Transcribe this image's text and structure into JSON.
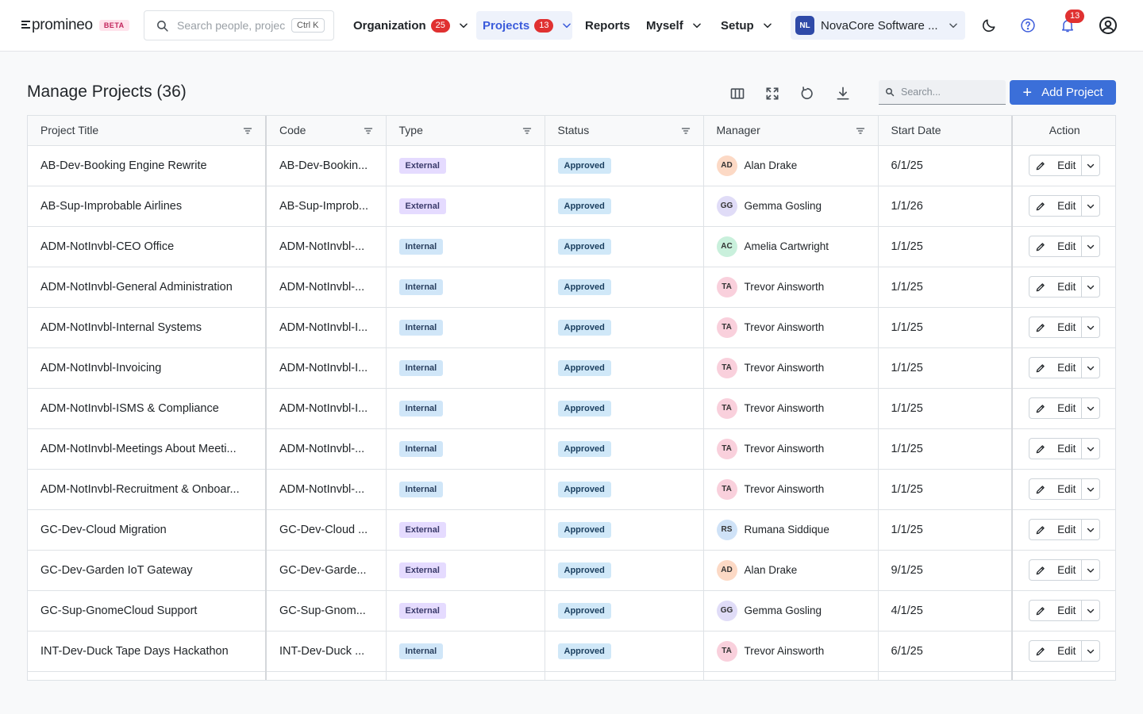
{
  "app": {
    "logo_text": "promineo",
    "beta_label": "BETA",
    "search_placeholder": "Search people, projects",
    "search_shortcut": "Ctrl K"
  },
  "nav": {
    "organization": {
      "label": "Organization",
      "badge": "25"
    },
    "projects": {
      "label": "Projects",
      "badge": "13"
    },
    "reports": {
      "label": "Reports"
    },
    "myself": {
      "label": "Myself"
    },
    "setup": {
      "label": "Setup"
    }
  },
  "org_switcher": {
    "initials": "NL",
    "name": "NovaCore Software ..."
  },
  "notifications": {
    "count": "13"
  },
  "page": {
    "title": "Manage Projects (36)",
    "search_placeholder": "Search...",
    "add_label": "Add Project"
  },
  "table": {
    "columns": [
      "Project Title",
      "Code",
      "Type",
      "Status",
      "Manager",
      "Start Date",
      "Action"
    ],
    "edit_label": "Edit",
    "rows": [
      {
        "title": "AB-Dev-Booking Engine Rewrite",
        "code": "AB-Dev-Bookin...",
        "type": "External",
        "status": "Approved",
        "initials": "AD",
        "manager": "Alan Drake",
        "start": "6/1/25"
      },
      {
        "title": "AB-Sup-Improbable Airlines",
        "code": "AB-Sup-Improb...",
        "type": "External",
        "status": "Approved",
        "initials": "GG",
        "manager": "Gemma Gosling",
        "start": "1/1/26"
      },
      {
        "title": "ADM-NotInvbl-CEO Office",
        "code": "ADM-NotInvbl-...",
        "type": "Internal",
        "status": "Approved",
        "initials": "AC",
        "manager": "Amelia Cartwright",
        "start": "1/1/25"
      },
      {
        "title": "ADM-NotInvbl-General Administration",
        "code": "ADM-NotInvbl-...",
        "type": "Internal",
        "status": "Approved",
        "initials": "TA",
        "manager": "Trevor Ainsworth",
        "start": "1/1/25"
      },
      {
        "title": "ADM-NotInvbl-Internal Systems",
        "code": "ADM-NotInvbl-I...",
        "type": "Internal",
        "status": "Approved",
        "initials": "TA",
        "manager": "Trevor Ainsworth",
        "start": "1/1/25"
      },
      {
        "title": "ADM-NotInvbl-Invoicing",
        "code": "ADM-NotInvbl-I...",
        "type": "Internal",
        "status": "Approved",
        "initials": "TA",
        "manager": "Trevor Ainsworth",
        "start": "1/1/25"
      },
      {
        "title": "ADM-NotInvbl-ISMS & Compliance",
        "code": "ADM-NotInvbl-I...",
        "type": "Internal",
        "status": "Approved",
        "initials": "TA",
        "manager": "Trevor Ainsworth",
        "start": "1/1/25"
      },
      {
        "title": "ADM-NotInvbl-Meetings About Meeti...",
        "code": "ADM-NotInvbl-...",
        "type": "Internal",
        "status": "Approved",
        "initials": "TA",
        "manager": "Trevor Ainsworth",
        "start": "1/1/25"
      },
      {
        "title": "ADM-NotInvbl-Recruitment & Onboar...",
        "code": "ADM-NotInvbl-...",
        "type": "Internal",
        "status": "Approved",
        "initials": "TA",
        "manager": "Trevor Ainsworth",
        "start": "1/1/25"
      },
      {
        "title": "GC-Dev-Cloud Migration",
        "code": "GC-Dev-Cloud ...",
        "type": "External",
        "status": "Approved",
        "initials": "RS",
        "manager": "Rumana Siddique",
        "start": "1/1/25"
      },
      {
        "title": "GC-Dev-Garden IoT Gateway",
        "code": "GC-Dev-Garde...",
        "type": "External",
        "status": "Approved",
        "initials": "AD",
        "manager": "Alan Drake",
        "start": "9/1/25"
      },
      {
        "title": "GC-Sup-GnomeCloud Support",
        "code": "GC-Sup-Gnom...",
        "type": "External",
        "status": "Approved",
        "initials": "GG",
        "manager": "Gemma Gosling",
        "start": "4/1/25"
      },
      {
        "title": "INT-Dev-Duck Tape Days Hackathon",
        "code": "INT-Dev-Duck ...",
        "type": "Internal",
        "status": "Approved",
        "initials": "TA",
        "manager": "Trevor Ainsworth",
        "start": "6/1/25"
      }
    ]
  },
  "colors": {
    "accent": "#3b6fd9",
    "nav_active": "#3b5bdb",
    "badge": "#e03131",
    "avatar_AD": "#fcd9c5",
    "avatar_GG": "#e0dcf7",
    "avatar_AC": "#c9f0dc",
    "avatar_TA": "#f9d0dc",
    "avatar_RS": "#cfe2f7"
  },
  "icons": [
    "search-icon",
    "chevron-down-icon",
    "moon-icon",
    "help-icon",
    "bell-icon",
    "account-icon",
    "columns-icon",
    "fullscreen-icon",
    "refresh-icon",
    "download-icon",
    "filter-icon",
    "pencil-icon",
    "plus-icon"
  ]
}
